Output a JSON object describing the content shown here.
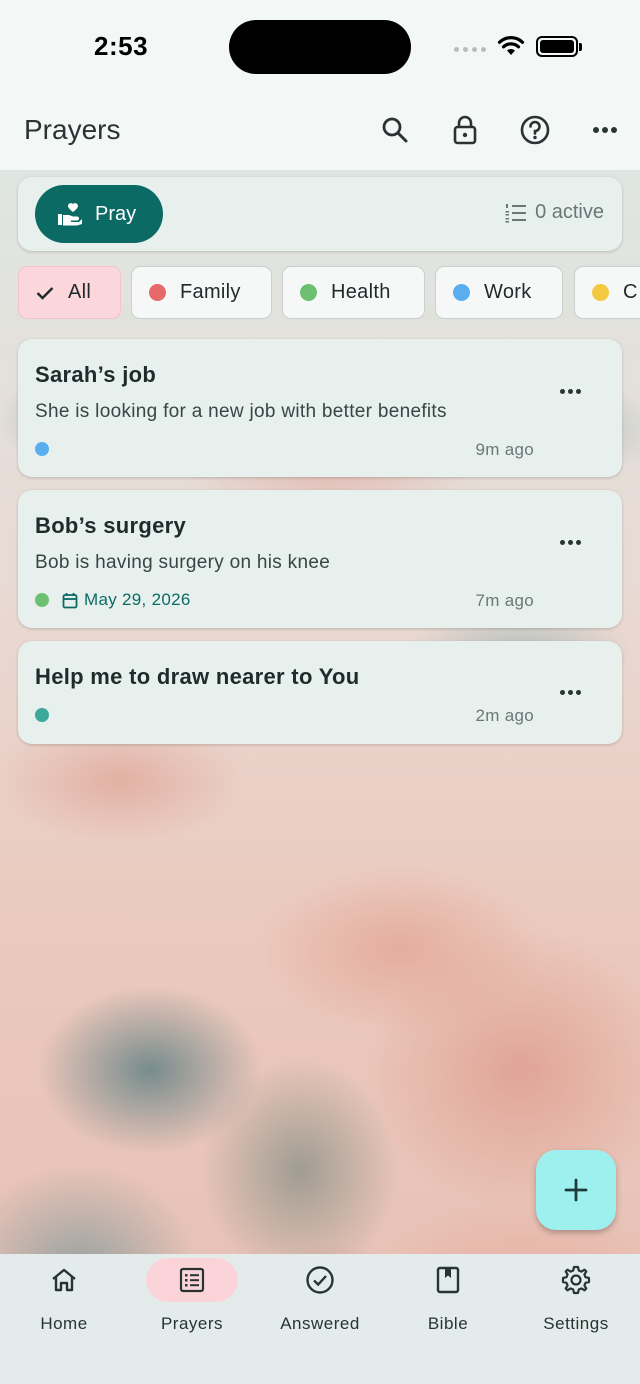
{
  "status_bar": {
    "time": "2:53"
  },
  "app_bar": {
    "title": "Prayers"
  },
  "pray_bar": {
    "pray_label": "Pray",
    "active_count": "0 active"
  },
  "filters": [
    {
      "label": "All",
      "selected": true
    },
    {
      "label": "Family",
      "color": "#e66a6a"
    },
    {
      "label": "Health",
      "color": "#6cc070"
    },
    {
      "label": "Work",
      "color": "#5aaef0"
    },
    {
      "label": "C",
      "color": "#f5c842"
    }
  ],
  "prayers": [
    {
      "title": "Sarah’s job",
      "body": "She is looking for a new job with better benefits",
      "dot_color": "#5aaef0",
      "time": "9m ago"
    },
    {
      "title": "Bob’s surgery",
      "body": "Bob is having surgery on his knee",
      "dot_color": "#6cc070",
      "date": "May 29, 2026",
      "time": "7m ago"
    },
    {
      "title": "Help me to draw nearer to You",
      "dot_color": "#3aa89a",
      "time": "2m ago"
    }
  ],
  "nav": [
    {
      "label": "Home",
      "icon": "home-icon"
    },
    {
      "label": "Prayers",
      "icon": "list-icon",
      "active": true
    },
    {
      "label": "Answered",
      "icon": "check-circle-icon"
    },
    {
      "label": "Bible",
      "icon": "book-icon"
    },
    {
      "label": "Settings",
      "icon": "gear-icon"
    }
  ],
  "colors": {
    "accent": "#0b6b64",
    "fab": "#9ef0ee",
    "selected_chip": "#fbd7dc"
  }
}
